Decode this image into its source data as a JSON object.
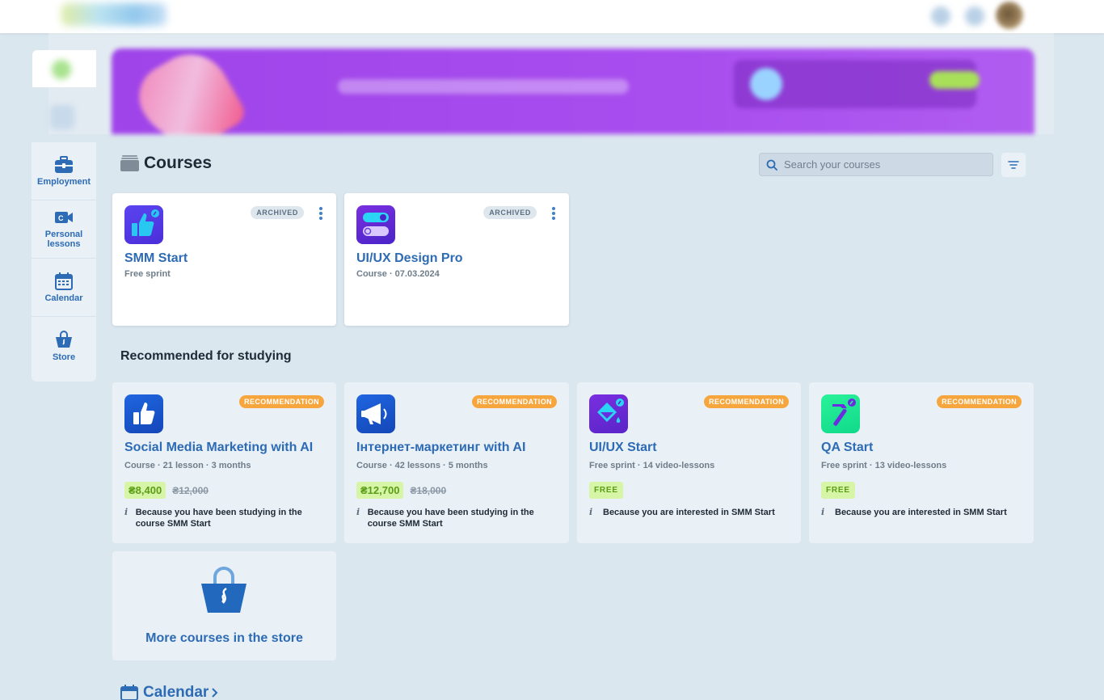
{
  "sidebar": {
    "items": [
      {
        "label": "Employment",
        "icon": "briefcase-icon"
      },
      {
        "label": "Personal lessons",
        "icon": "video-camera-icon"
      },
      {
        "label": "Calendar",
        "icon": "calendar-icon"
      },
      {
        "label": "Store",
        "icon": "shopping-bag-icon"
      }
    ]
  },
  "courses": {
    "title": "Courses",
    "search_placeholder": "Search your courses",
    "items": [
      {
        "title": "SMM Start",
        "subtitle": "Free sprint",
        "badge": "ARCHIVED",
        "icon": "thumbs-up-icon"
      },
      {
        "title": "UI/UX Design Pro",
        "subtitle": "Course · 07.03.2024",
        "badge": "ARCHIVED",
        "icon": "toggle-icon"
      }
    ]
  },
  "recommended": {
    "title": "Recommended for studying",
    "items": [
      {
        "title": "Social Media Marketing with AI",
        "meta": "Course · 21 lesson · 3 months",
        "badge": "RECOMMENDATION",
        "price": "₴8,400",
        "old_price": "₴12,000",
        "reason": "Because you have been studying in the course SMM Start",
        "icon": "thumbs-up-icon"
      },
      {
        "title": "Інтернет-маркетинг with AI",
        "meta": "Course · 42 lessons · 5 months",
        "badge": "RECOMMENDATION",
        "price": "₴12,700",
        "old_price": "₴18,000",
        "reason": "Because you have been studying in the course SMM Start",
        "icon": "megaphone-icon"
      },
      {
        "title": "UI/UX Start",
        "meta": "Free sprint · 14 video-lessons",
        "badge": "RECOMMENDATION",
        "free_label": "FREE",
        "reason": "Because you are interested in SMM Start",
        "icon": "paint-bucket-icon"
      },
      {
        "title": "QA Start",
        "meta": "Free sprint · 13 video-lessons",
        "badge": "RECOMMENDATION",
        "free_label": "FREE",
        "reason": "Because you are interested in SMM Start",
        "icon": "hammer-icon"
      }
    ]
  },
  "store_card": {
    "label": "More courses in the store"
  },
  "calendar": {
    "title": "Calendar"
  },
  "colors": {
    "accent_blue": "#2d6bb5",
    "recommendation_orange": "#f7a63d",
    "price_green": "#5a9d16",
    "banner_purple": "#a84dee"
  }
}
